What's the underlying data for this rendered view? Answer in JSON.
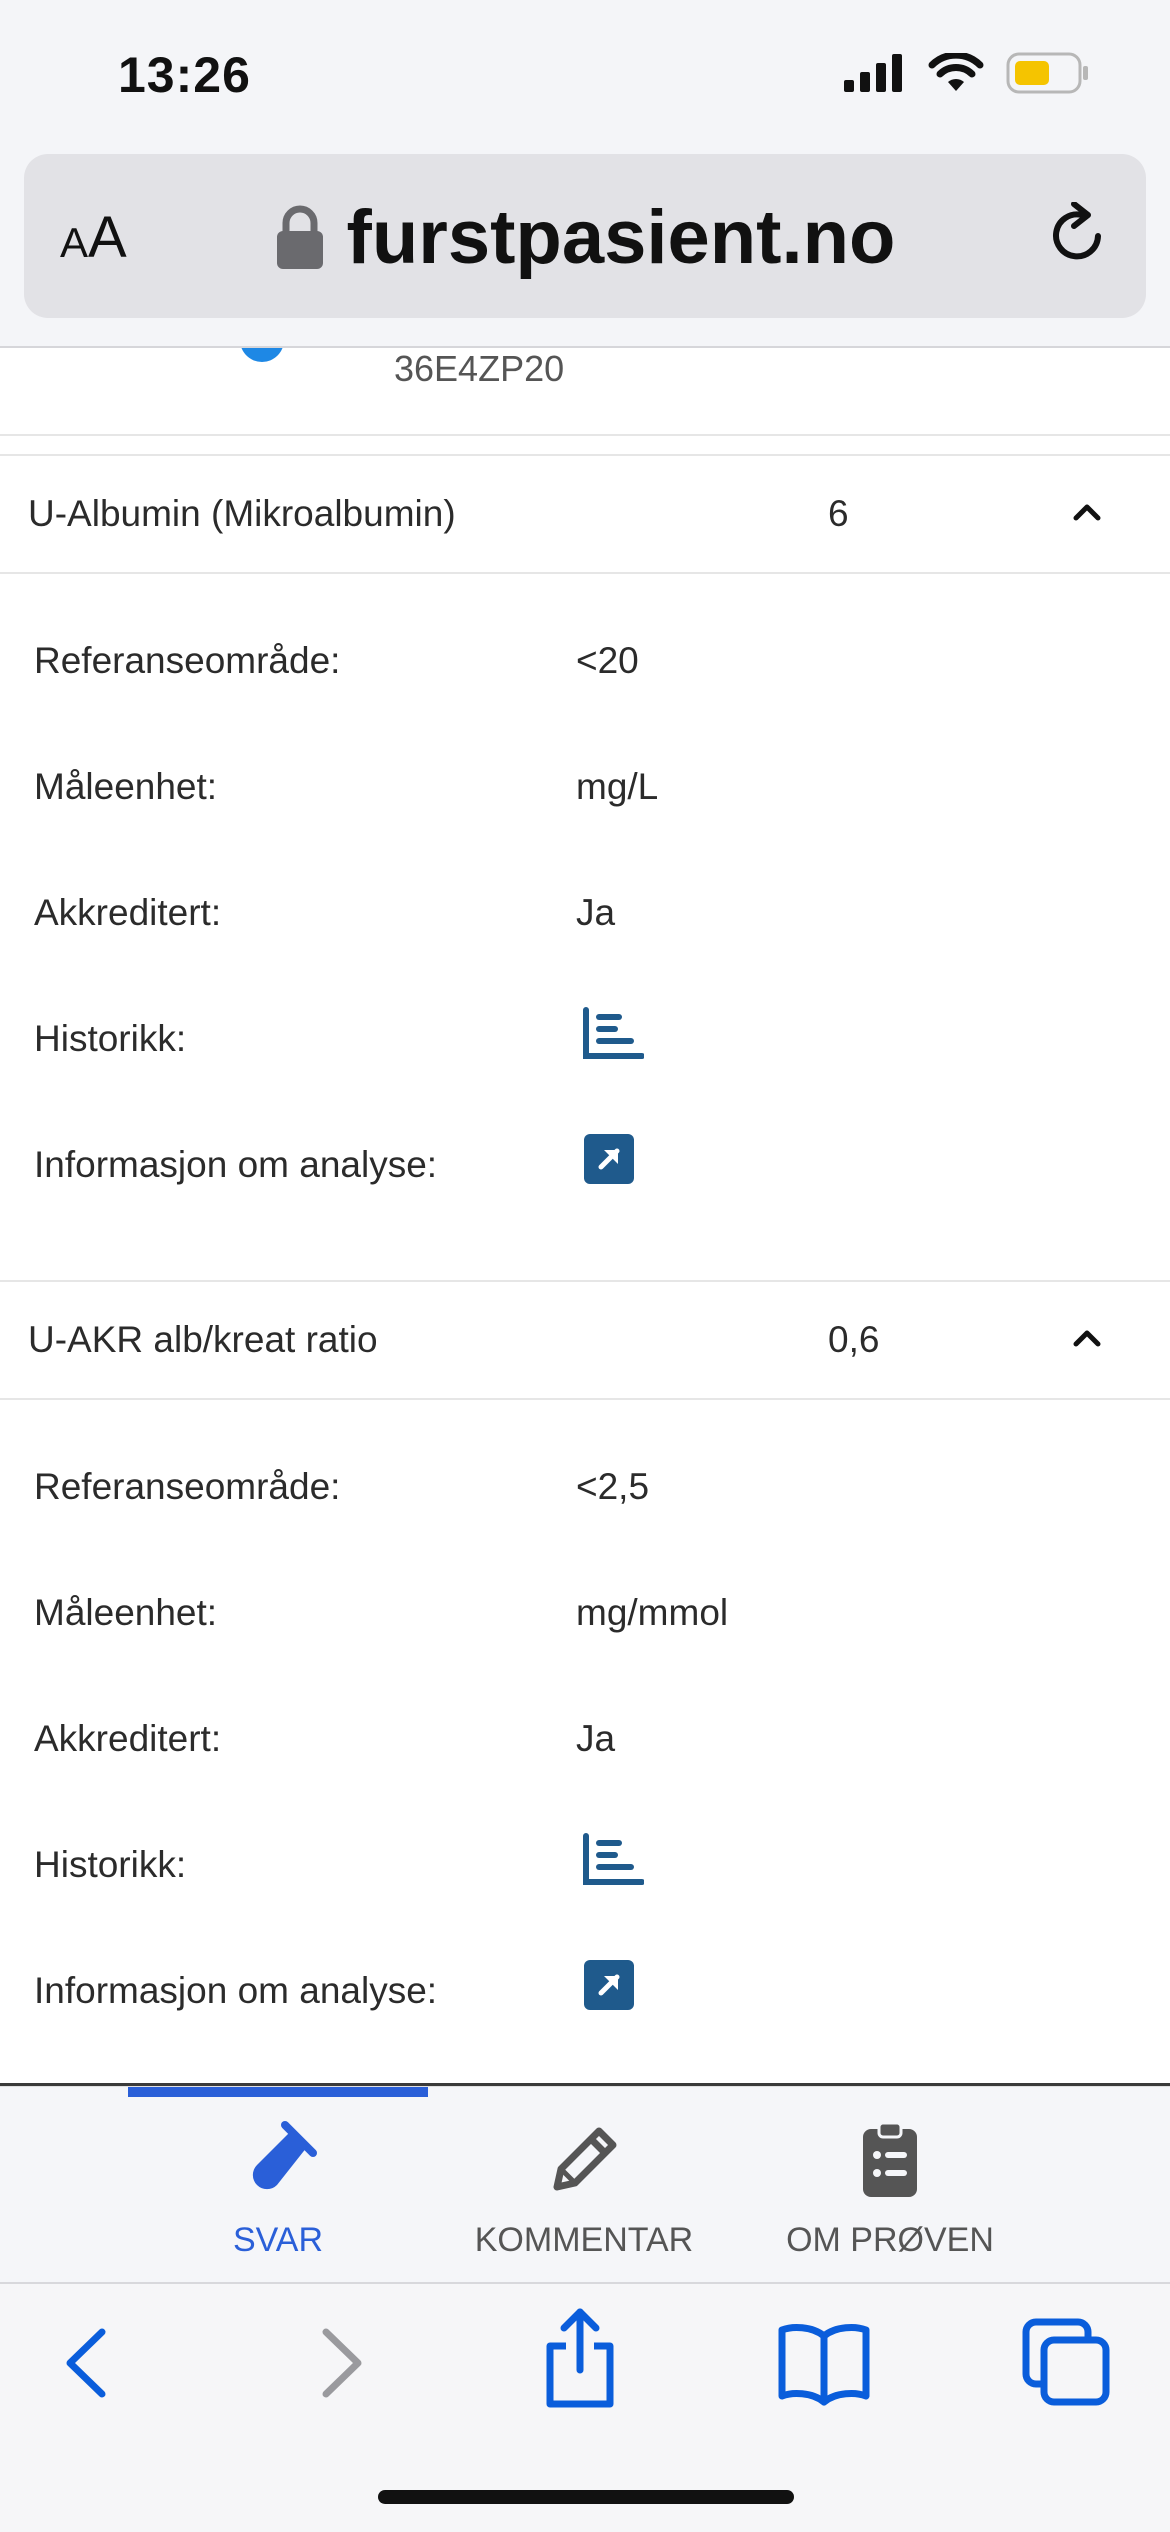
{
  "status": {
    "time": "13:26"
  },
  "browser": {
    "aa_label": "AA",
    "url": "furstpasient.no"
  },
  "fragment": {
    "code": "36E4ZP20"
  },
  "analyses": [
    {
      "name": "U-Albumin (Mikroalbumin)",
      "value": "6",
      "reference_label": "Referanseområde:",
      "reference_value": "<20",
      "unit_label": "Måleenhet:",
      "unit_value": "mg/L",
      "accredited_label": "Akkreditert:",
      "accredited_value": "Ja",
      "history_label": "Historikk:",
      "info_label": "Informasjon om analyse:"
    },
    {
      "name": "U-AKR alb/kreat ratio",
      "value": "0,6",
      "reference_label": "Referanseområde:",
      "reference_value": "<2,5",
      "unit_label": "Måleenhet:",
      "unit_value": "mg/mmol",
      "accredited_label": "Akkreditert:",
      "accredited_value": "Ja",
      "history_label": "Historikk:",
      "info_label": "Informasjon om analyse:"
    }
  ],
  "tabs": [
    {
      "label": "SVAR",
      "icon": "test-tube-icon",
      "active": true
    },
    {
      "label": "KOMMENTAR",
      "icon": "pencil-icon",
      "active": false
    },
    {
      "label": "OM PRØVEN",
      "icon": "clipboard-list-icon",
      "active": false
    }
  ],
  "colors": {
    "accent": "#2a5fd8",
    "icon_blue": "#1f5a8c",
    "safari_blue": "#0a5ddb"
  }
}
